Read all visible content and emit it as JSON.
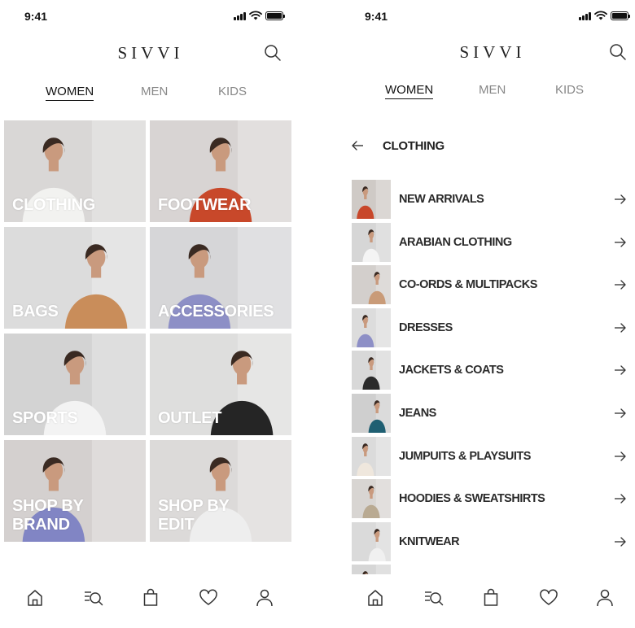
{
  "status": {
    "time": "9:41"
  },
  "brand": "SIVVI",
  "tabs": [
    "WOMEN",
    "MEN",
    "KIDS"
  ],
  "active_tab": "WOMEN",
  "categories": [
    {
      "label": "CLOTHING",
      "bg": "#d9d7d6",
      "accent": "#f2f2f0"
    },
    {
      "label": "FOOTWEAR",
      "bg": "#d8d4d3",
      "accent": "#c8482a"
    },
    {
      "label": "BAGS",
      "bg": "#dcdcdc",
      "accent": "#c98d5a"
    },
    {
      "label": "ACCESSORIES",
      "bg": "#d6d6d8",
      "accent": "#8d8fc6"
    },
    {
      "label": "SPORTS",
      "bg": "#d3d3d3",
      "accent": "#f3f3f3"
    },
    {
      "label": "OUTLET",
      "bg": "#dededd",
      "accent": "#252525"
    },
    {
      "label": "SHOP BY\nBRAND",
      "bg": "#d4d0cf",
      "accent": "#8185c4"
    },
    {
      "label": "SHOP BY\nEDIT",
      "bg": "#dcdad9",
      "accent": "#eeeeee"
    }
  ],
  "subcategory_title": "CLOTHING",
  "subcategories": [
    {
      "label": "NEW ARRIVALS",
      "bg": "#cfcac6",
      "accent": "#c8472a"
    },
    {
      "label": "ARABIAN CLOTHING",
      "bg": "#d6d6d6",
      "accent": "#f4f4f4"
    },
    {
      "label": "CO-ORDS & MULTIPACKS",
      "bg": "#d3cfcc",
      "accent": "#c99b78"
    },
    {
      "label": "DRESSES",
      "bg": "#dcdcdc",
      "accent": "#8d8fc6"
    },
    {
      "label": "JACKETS & COATS",
      "bg": "#d8d8d8",
      "accent": "#2b2b2b"
    },
    {
      "label": "JEANS",
      "bg": "#cfcfcf",
      "accent": "#1f5f72"
    },
    {
      "label": "JUMPUITS & PLAYSUITS",
      "bg": "#dbdbdb",
      "accent": "#efe7dd"
    },
    {
      "label": "HOODIES & SWEATSHIRTS",
      "bg": "#d8d5d2",
      "accent": "#b9aa92"
    },
    {
      "label": "KNITWEAR",
      "bg": "#dadada",
      "accent": "#f0f0f0"
    },
    {
      "label": "",
      "bg": "#d6d6d6",
      "accent": "#bbbbbb"
    }
  ],
  "bottom_nav": [
    "home-icon",
    "browse-search-icon",
    "bag-icon",
    "heart-icon",
    "profile-icon"
  ]
}
